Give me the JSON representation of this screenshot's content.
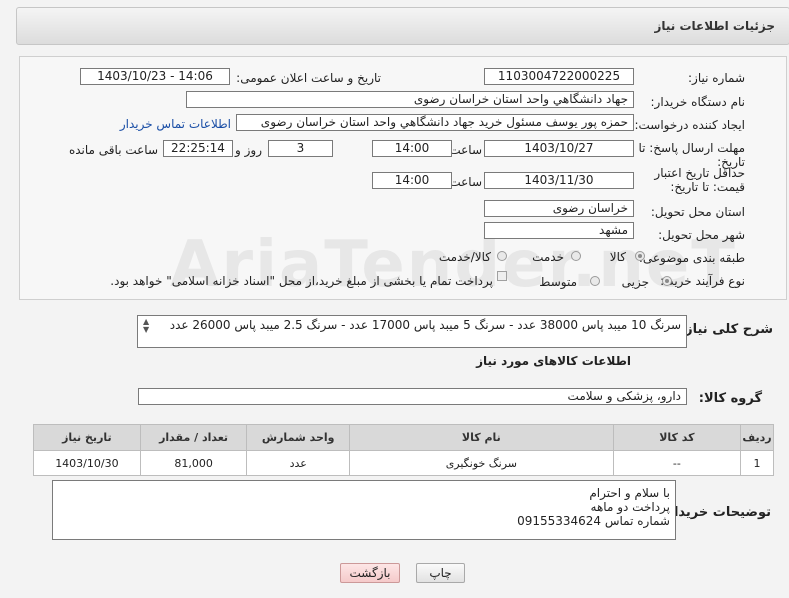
{
  "header": {
    "title": "جزئیات اطلاعات نیاز"
  },
  "fields": {
    "need_number_label": "شماره نیاز:",
    "need_number": "1103004722000225",
    "announce_label": "تاریخ و ساعت اعلان عمومی:",
    "announce_value": "1403/10/23 - 14:06",
    "buyer_org_label": "نام دستگاه خریدار:",
    "buyer_org": "جهاد دانشگاهي واحد استان خراسان رضوی",
    "creator_label": "ایجاد کننده درخواست:",
    "creator": "حمزه  پور یوسف مسئول خرید جهاد دانشگاهي واحد استان خراسان رضوی",
    "contact_link": "اطلاعات تماس خریدار",
    "deadline_label": "مهلت ارسال پاسخ: تا تاریخ:",
    "deadline_date": "1403/10/27",
    "time_label": "ساعت",
    "deadline_time": "14:00",
    "days_value": "3",
    "days_and_label": "روز و",
    "remaining_time": "22:25:14",
    "remaining_label": "ساعت باقی مانده",
    "validity_label": "حداقل تاریخ اعتبار قیمت: تا تاریخ:",
    "validity_date": "1403/11/30",
    "validity_time": "14:00",
    "province_label": "استان محل تحویل:",
    "province": "خراسان رضوی",
    "city_label": "شهر محل تحویل:",
    "city": "مشهد",
    "category_label": "طبقه بندی موضوعی:",
    "category_options": [
      "کالا",
      "خدمت",
      "کالا/خدمت"
    ],
    "process_label": "نوع فرآیند خرید :",
    "process_options": [
      "جزیی",
      "متوسط"
    ],
    "payment_note": "پرداخت تمام یا بخشی از مبلغ خرید،از محل \"اسناد خزانه اسلامی\" خواهد بود.",
    "summary_label": "شرح کلی نیاز:",
    "summary": "سرنگ 10 میبد پاس 38000 عدد - سرنگ 5 میبد پاس 17000 عدد - سرنگ 2.5 میبد پاس 26000 عدد",
    "goods_info_title": "اطلاعات کالاهای مورد نیاز",
    "goods_group_label": "گروه کالا:",
    "goods_group": "دارو، پزشکی و سلامت"
  },
  "table": {
    "headers": [
      "ردیف",
      "کد کالا",
      "نام کالا",
      "واحد شمارش",
      "تعداد / مقدار",
      "تاریخ نیاز"
    ],
    "rows": [
      [
        "1",
        "--",
        "سرنگ خونگیری",
        "عدد",
        "81,000",
        "1403/10/30"
      ]
    ]
  },
  "notes": {
    "label": "توضیحات خریدار:",
    "lines": [
      "با سلام و احترام",
      "پرداخت دو ماهه",
      "شماره تماس 09155334624"
    ]
  },
  "buttons": {
    "print": "چاپ",
    "back": "بازگشت"
  },
  "watermark": "AriaTender.neT"
}
